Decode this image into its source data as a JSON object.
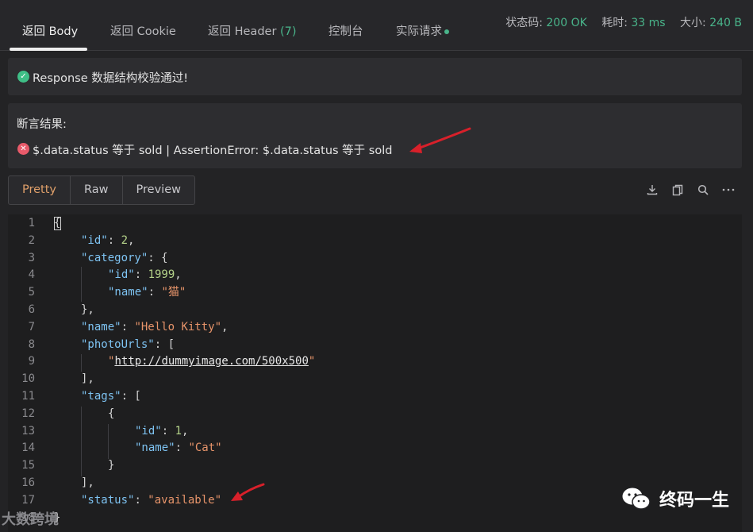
{
  "tabs": [
    {
      "label": "返回 Body",
      "active": true
    },
    {
      "label": "返回 Cookie"
    },
    {
      "label": "返回 Header ",
      "count": "(7)"
    },
    {
      "label": "控制台"
    },
    {
      "label": "实际请求"
    }
  ],
  "stats": {
    "status_label": "状态码:",
    "status_value": "200 OK",
    "time_label": "耗时:",
    "time_value": "33 ms",
    "size_label": "大小:",
    "size_value": "240 B"
  },
  "validation": {
    "text": "Response 数据结构校验通过!"
  },
  "assertion": {
    "title": "断言结果:",
    "text": "$.data.status 等于 sold | AssertionError: $.data.status 等于 sold"
  },
  "format_buttons": [
    "Pretty",
    "Raw",
    "Preview"
  ],
  "toolbar_icons": [
    "download-icon",
    "copy-icon",
    "search-icon",
    "more-icon"
  ],
  "code_lines": [
    "{",
    "\"id\": 2,",
    "\"category\": {",
    "\"id\": 1999,",
    "\"name\": \"猫\"",
    "},",
    "\"name\": \"Hello Kitty\",",
    "\"photoUrls\": [",
    "\"http://dummyimage.com/500x500\"",
    "],",
    "\"tags\": [",
    "{",
    "\"id\": 1,",
    "\"name\": \"Cat\"",
    "}",
    "],",
    "\"status\": \"available\"",
    "}"
  ],
  "line_numbers": [
    "1",
    "2",
    "3",
    "4",
    "5",
    "6",
    "7",
    "8",
    "9",
    "10",
    "11",
    "12",
    "13",
    "14",
    "15",
    "16",
    "17",
    "18"
  ],
  "watermarks": {
    "left": "大数跨境",
    "right": "终码一生"
  },
  "colors": {
    "accent_green": "#49b48a",
    "fail_red": "#e85a6a",
    "annotation_red": "#d8202a",
    "active_orange": "#e0a06a"
  }
}
